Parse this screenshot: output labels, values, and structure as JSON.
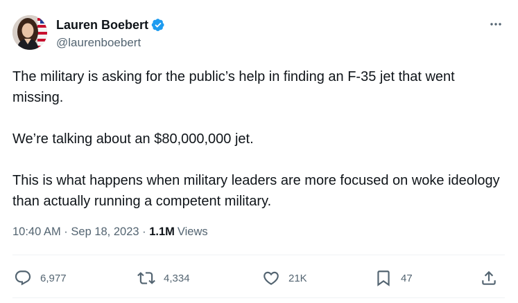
{
  "author": {
    "display_name": "Lauren Boebert",
    "handle": "@laurenboebert",
    "verified": true
  },
  "tweet": {
    "paragraphs": [
      "The military is asking for the public’s help in finding an F-35 jet that went missing.",
      "We’re talking about an $80,000,000 jet.",
      "This is what happens when military leaders are more focused on woke ideology than actually running a competent military."
    ],
    "time": "10:40 AM",
    "separator": " · ",
    "date": "Sep 18, 2023",
    "views_count": "1.1M",
    "views_label": "Views"
  },
  "actions": {
    "replies": "6,977",
    "reposts": "4,334",
    "likes": "21K",
    "bookmarks": "47"
  },
  "icons": {
    "verified": "verified-badge-icon",
    "more": "more-dots-icon",
    "reply": "reply-icon",
    "repost": "repost-icon",
    "like": "heart-icon",
    "bookmark": "bookmark-icon",
    "share": "share-icon"
  },
  "colors": {
    "text": "#0f1419",
    "secondary": "#536471",
    "verified": "#1d9bf0"
  }
}
